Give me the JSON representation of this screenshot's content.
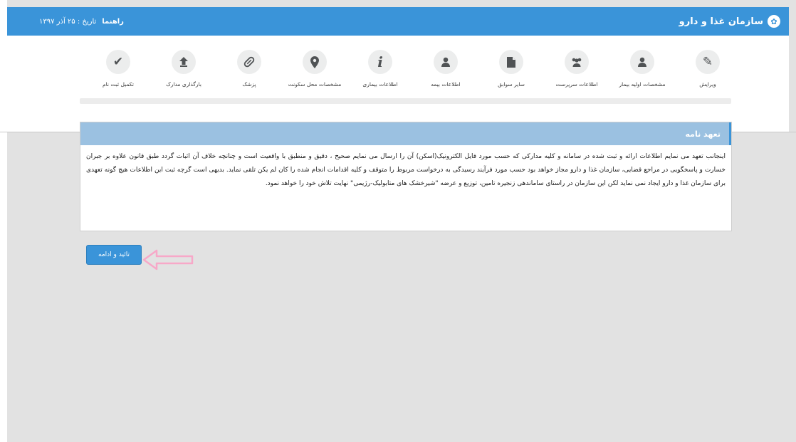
{
  "topbar": {
    "brand": "سازمان غذا و دارو",
    "help": "راهنما",
    "date": "تاریخ : ۲۵ آذر ۱۳۹۷"
  },
  "steps": [
    {
      "label": "ویرایش",
      "icon": "pencil-icon"
    },
    {
      "label": "مشخصات اولیه بیمار",
      "icon": "user-icon"
    },
    {
      "label": "اطلاعات سرپرست",
      "icon": "users-icon"
    },
    {
      "label": "سایر سوابق",
      "icon": "file-icon"
    },
    {
      "label": "اطلاعات بیمه",
      "icon": "user-icon"
    },
    {
      "label": "اطلاعات بیماری",
      "icon": "info-icon"
    },
    {
      "label": "مشخصات محل سکونت",
      "icon": "map-marker-icon"
    },
    {
      "label": "پزشک",
      "icon": "pill-icon"
    },
    {
      "label": "بارگذاری مدارک",
      "icon": "upload-icon"
    },
    {
      "label": "تکمیل ثبت نام",
      "icon": "checkmark-icon"
    }
  ],
  "card": {
    "title": "تعهد نامه",
    "body": "اینجانب تعهد می نمایم اطلاعات ارائه و ثبت شده در سامانه و کلیه مدارکی که حسب مورد فایل الکترونیک(اسکن) آن را ارسال می نمایم صحیح ، دقیق و منطبق با واقعیت است و چنانچه خلاف آن اثبات گردد طبق قانون علاوه بر جبران خسارت و پاسخگویی در مراجع قضایی، سازمان غذا و دارو مجاز خواهد بود حسب مورد فرآیند رسیدگی به درخواست مربوط را متوقف و کلیه اقدامات انجام شده را کان لم یکن تلقی نماید. بدیهی است گرچه ثبت این اطلاعات هیچ گونه تعهدی برای سازمان غذا و دارو ایجاد نمی نماید لکن این سازمان در راستای ساماندهی زنجیره تامین، توزیع و عرضه \"شیرخشک های متابولیک-رژیمی\" نهایت تلاش خود را خواهد نمود."
  },
  "confirm_button": "تائید و ادامه",
  "colors": {
    "accent": "#3a94d9",
    "card_header": "#9bc1e1",
    "annotation_arrow": "#f7a8c8"
  }
}
